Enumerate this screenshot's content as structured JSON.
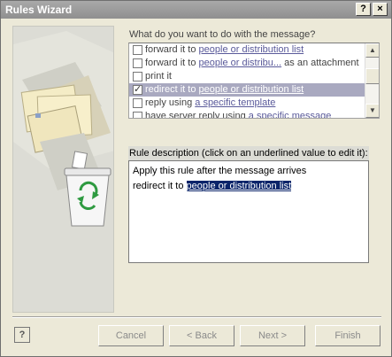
{
  "window": {
    "title": "Rules Wizard",
    "help_glyph": "?",
    "close_glyph": "×"
  },
  "actions_prompt": {
    "label": "What do you want to do with the message?"
  },
  "actions": [
    {
      "prefix": "forward it to ",
      "link": "people or distribution list",
      "suffix": "",
      "checked": false,
      "selected": false
    },
    {
      "prefix": "forward it to ",
      "link": "people or distribu...",
      "suffix": " as an attachment",
      "checked": false,
      "selected": false
    },
    {
      "prefix": "print it",
      "link": "",
      "suffix": "",
      "checked": false,
      "selected": false
    },
    {
      "prefix": "redirect it to ",
      "link": "people or distribution list",
      "suffix": "",
      "checked": true,
      "selected": true
    },
    {
      "prefix": "reply using ",
      "link": "a specific template",
      "suffix": "",
      "checked": false,
      "selected": false
    },
    {
      "prefix": "have server reply using ",
      "link": "a specific message",
      "suffix": "",
      "checked": false,
      "selected": false
    }
  ],
  "description": {
    "label": "Rule description (click on an underlined value to edit it):",
    "line1": "Apply this rule after the message arrives",
    "line2_prefix": "redirect it to ",
    "line2_link": "people or distribution list"
  },
  "buttons": {
    "help": "?",
    "cancel": "Cancel",
    "back": "< Back",
    "next": "Next >",
    "finish": "Finish"
  },
  "colors": {
    "selection": "#a9a9c0",
    "highlight": "#0a246a",
    "titlebar": "#999999"
  },
  "icons": {
    "illustration": "envelopes-and-recycle-bin-illustration"
  }
}
